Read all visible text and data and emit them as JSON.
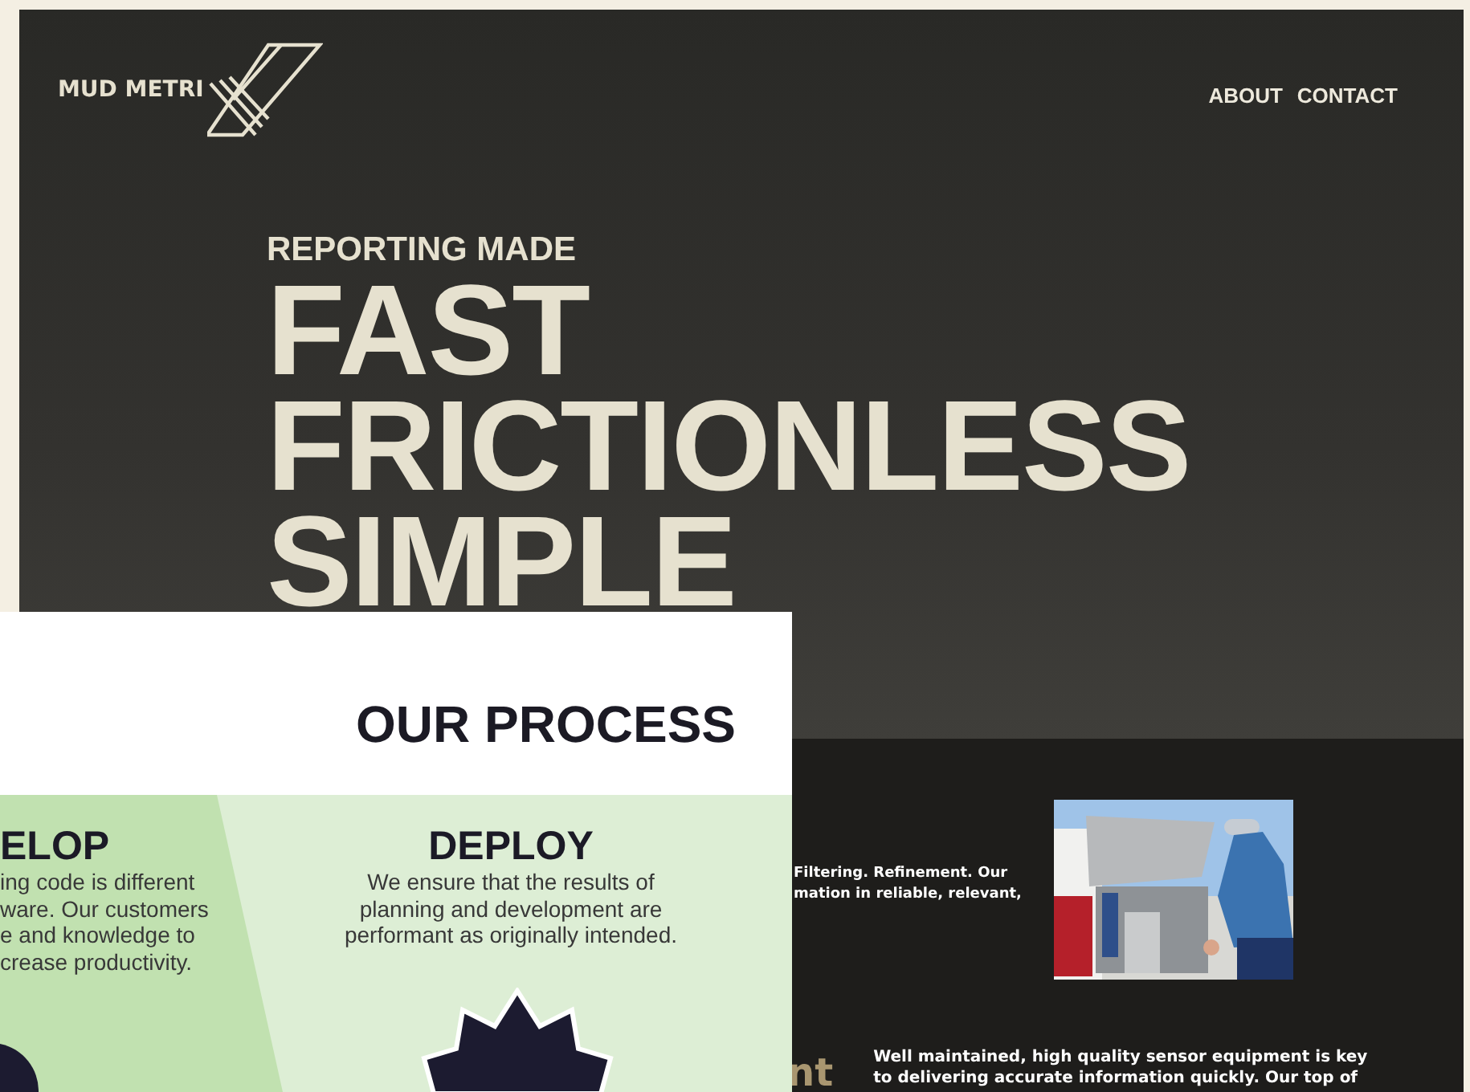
{
  "site": {
    "logo": "MUD METRI",
    "nav": [
      {
        "label": "ABOUT"
      },
      {
        "label": "CONTACT"
      }
    ]
  },
  "hero": {
    "kicker": "REPORTING MADE",
    "lines": [
      "FAST",
      "FRICTIONLESS",
      "SIMPLE"
    ]
  },
  "content": {
    "intro_lines": [
      "Filtering. Refinement. Our",
      "mation in reliable, relevant,"
    ],
    "heading_fragment": "nt",
    "equipment_lines": [
      "Well maintained, high quality sensor equipment is key",
      "to delivering accurate information quickly. Our top of"
    ]
  },
  "process_card": {
    "title": "OUR PROCESS",
    "steps": [
      {
        "title": "ELOP",
        "lines": [
          "ing code is different",
          "ware. Our customers",
          "e and knowledge to",
          "crease productivity."
        ]
      },
      {
        "title": "DEPLOY",
        "lines": [
          "We ensure that the results of",
          "planning and development are",
          "performant as originally intended."
        ]
      }
    ]
  }
}
